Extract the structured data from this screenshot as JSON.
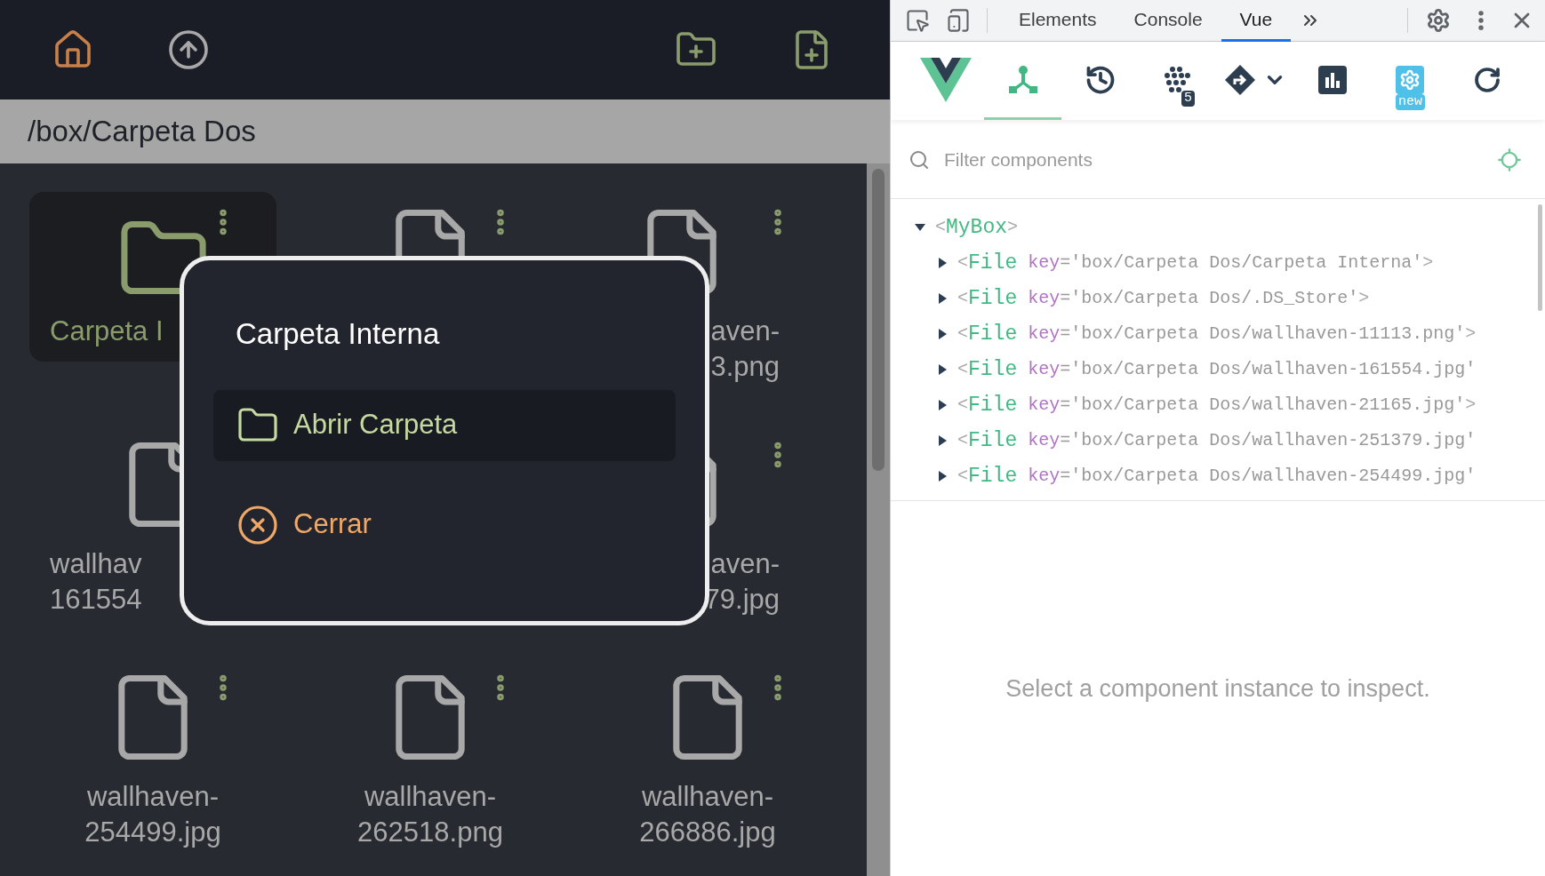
{
  "toolbar": {
    "left": [
      {
        "kind": "home"
      },
      {
        "kind": "up"
      }
    ],
    "right": [
      {
        "kind": "new-folder"
      },
      {
        "kind": "new-file"
      }
    ]
  },
  "path": "/box/Carpeta Dos",
  "grid": {
    "rows": [
      [
        {
          "kind": "folder",
          "selected": true,
          "menu": true,
          "clipped": true,
          "lines": [
            "Carpeta I"
          ]
        },
        {
          "kind": "file",
          "selected": false,
          "menu": true,
          "clipped": true
        },
        {
          "kind": "file",
          "selected": false,
          "menu": true,
          "clipped": true,
          "lines": [
            "aven-",
            "3.png"
          ]
        }
      ],
      [
        {
          "kind": "file",
          "selected": false,
          "menu": false,
          "clipped": true,
          "lines": [
            "wallhav",
            "161554"
          ]
        },
        {
          "kind": "hidden"
        },
        {
          "kind": "file",
          "selected": false,
          "menu": true,
          "clipped": true,
          "lines": [
            "aven-",
            "79.jpg"
          ]
        }
      ],
      [
        {
          "kind": "file",
          "selected": false,
          "menu": true,
          "lines": [
            "wallhaven-",
            "254499.jpg"
          ]
        },
        {
          "kind": "file",
          "selected": false,
          "menu": true,
          "lines": [
            "wallhaven-",
            "262518.png"
          ]
        },
        {
          "kind": "file",
          "selected": false,
          "menu": true,
          "lines": [
            "wallhaven-",
            "266886.jpg"
          ]
        }
      ]
    ]
  },
  "dialog": {
    "title": "Carpeta Interna",
    "actions": [
      {
        "kind": "open",
        "label": "Abrir Carpeta",
        "selected": true
      },
      {
        "kind": "close",
        "label": "Cerrar",
        "selected": false
      }
    ]
  },
  "devtools": {
    "tabs": [
      {
        "label": "Elements",
        "selected": false
      },
      {
        "label": "Console",
        "selected": false
      },
      {
        "label": "Vue",
        "selected": true
      }
    ],
    "tools": [
      {
        "kind": "logo",
        "selected": false
      },
      {
        "kind": "components",
        "selected": true
      },
      {
        "kind": "timeline",
        "selected": false
      },
      {
        "kind": "plugins",
        "selected": false,
        "badge": "5"
      },
      {
        "kind": "router",
        "selected": false
      },
      {
        "kind": "performance",
        "selected": false
      },
      {
        "kind": "settings",
        "selected": false,
        "badge": "new"
      },
      {
        "kind": "refresh",
        "selected": false
      }
    ],
    "filter": {
      "placeholder": "Filter components"
    },
    "tree": [
      {
        "open": "<",
        "tag": "MyBox",
        "close": ">",
        "expanded": true,
        "children": [
          {
            "open": "<",
            "tag": "File",
            "attr": "key",
            "eq": "=",
            "value": "'box/Carpeta Dos/Carpeta Interna'",
            "close": ">",
            "expanded": false
          },
          {
            "open": "<",
            "tag": "File",
            "attr": "key",
            "eq": "=",
            "value": "'box/Carpeta Dos/.DS_Store'",
            "close": ">",
            "expanded": false
          },
          {
            "open": "<",
            "tag": "File",
            "attr": "key",
            "eq": "=",
            "value": "'box/Carpeta Dos/wallhaven-11113.png'",
            "close": ">",
            "expanded": false
          },
          {
            "open": "<",
            "tag": "File",
            "attr": "key",
            "eq": "=",
            "value": "'box/Carpeta Dos/wallhaven-161554.jpg'",
            "expanded": false
          },
          {
            "open": "<",
            "tag": "File",
            "attr": "key",
            "eq": "=",
            "value": "'box/Carpeta Dos/wallhaven-21165.jpg'",
            "close": ">",
            "expanded": false
          },
          {
            "open": "<",
            "tag": "File",
            "attr": "key",
            "eq": "=",
            "value": "'box/Carpeta Dos/wallhaven-251379.jpg'",
            "expanded": false
          },
          {
            "open": "<",
            "tag": "File",
            "attr": "key",
            "eq": "=",
            "value": "'box/Carpeta Dos/wallhaven-254499.jpg'",
            "expanded": false
          }
        ]
      }
    ],
    "empty_message": "Select a component instance to inspect."
  }
}
